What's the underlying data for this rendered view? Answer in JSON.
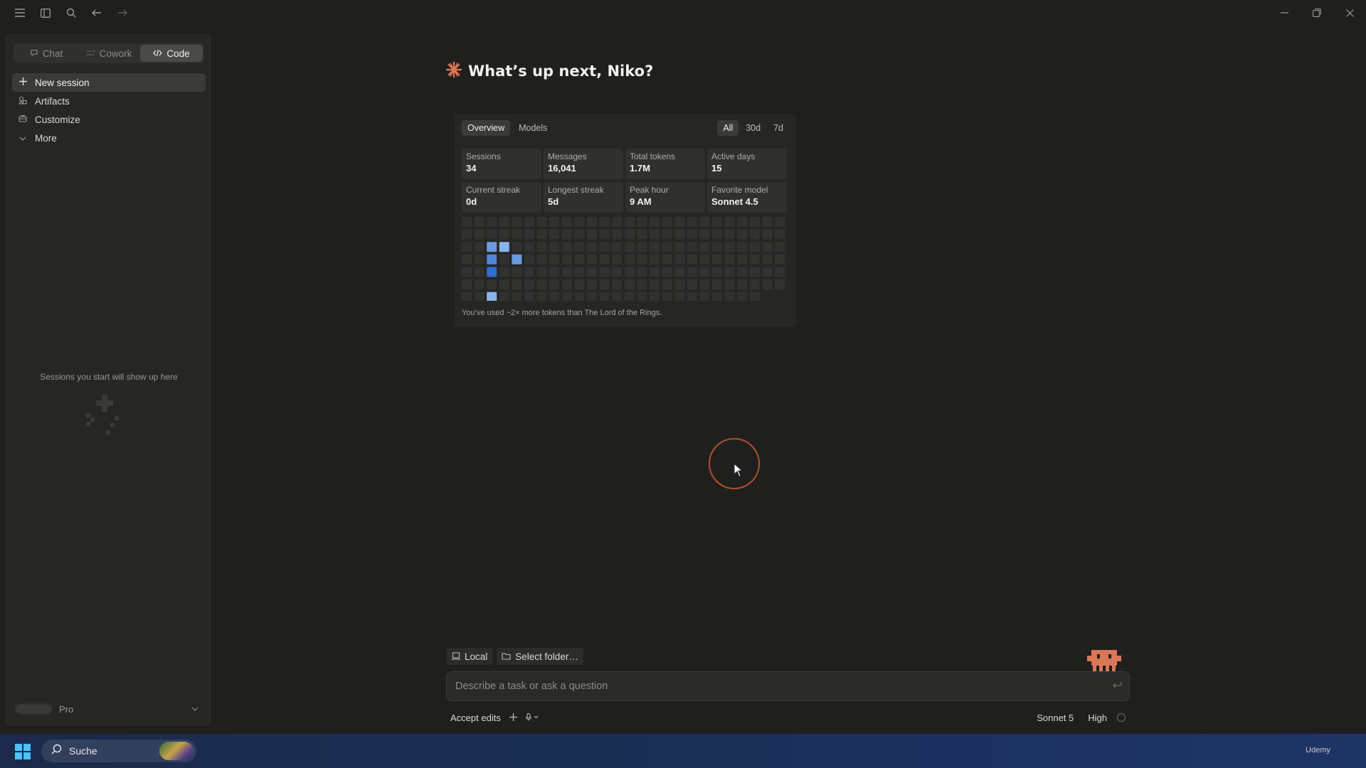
{
  "titlebar": {
    "icons": [
      "menu-icon",
      "sidebar-toggle-icon",
      "search-icon",
      "back-arrow-icon",
      "forward-arrow-icon"
    ],
    "window_controls": [
      "minimize-icon",
      "maximize-icon",
      "close-icon"
    ]
  },
  "sidebar": {
    "modes": [
      {
        "label": "Chat",
        "icon": "chat-icon",
        "active": false
      },
      {
        "label": "Cowork",
        "icon": "cowork-icon",
        "active": false
      },
      {
        "label": "Code",
        "icon": "code-icon",
        "active": true
      }
    ],
    "nav": [
      {
        "label": "New session",
        "icon": "plus-icon",
        "active": true
      },
      {
        "label": "Artifacts",
        "icon": "artifacts-icon",
        "active": false
      },
      {
        "label": "Customize",
        "icon": "customize-icon",
        "active": false
      },
      {
        "label": "More",
        "icon": "chevron-down-icon",
        "active": false
      }
    ],
    "empty_text": "Sessions you start will show up here",
    "account": {
      "plan": "Pro"
    }
  },
  "main": {
    "greeting": "What’s up next, Niko?",
    "accent_color": "#d97757"
  },
  "stats": {
    "tabs": [
      {
        "label": "Overview",
        "active": true
      },
      {
        "label": "Models",
        "active": false
      }
    ],
    "ranges": [
      {
        "label": "All",
        "active": true
      },
      {
        "label": "30d",
        "active": false
      },
      {
        "label": "7d",
        "active": false
      }
    ],
    "cards": [
      {
        "label": "Sessions",
        "value": "34"
      },
      {
        "label": "Messages",
        "value": "16,041"
      },
      {
        "label": "Total tokens",
        "value": "1.7M"
      },
      {
        "label": "Active days",
        "value": "15"
      },
      {
        "label": "Current streak",
        "value": "0d"
      },
      {
        "label": "Longest streak",
        "value": "5d"
      },
      {
        "label": "Peak hour",
        "value": "9 AM"
      },
      {
        "label": "Favorite model",
        "value": "Sonnet 4.5"
      }
    ],
    "heatmap": {
      "weeks": 26,
      "days": 7,
      "active_cells": [
        {
          "week": 2,
          "day": 2,
          "level": 2
        },
        {
          "week": 3,
          "day": 2,
          "level": 1
        },
        {
          "week": 2,
          "day": 3,
          "level": 3
        },
        {
          "week": 4,
          "day": 3,
          "level": 2
        },
        {
          "week": 2,
          "day": 4,
          "level": 4
        },
        {
          "week": 2,
          "day": 6,
          "level": 1
        }
      ],
      "colors": {
        "empty": "#313130",
        "l1": "#8ab4f0",
        "l2": "#6a9be0",
        "l3": "#4f86d8",
        "l4": "#2f6fd0"
      }
    },
    "caption": "You’ve used ~2× more tokens than The Lord of the Rings."
  },
  "composer": {
    "env_local": "Local",
    "env_folder": "Select folder…",
    "placeholder": "Describe a task or ask a question",
    "mode": "Accept edits",
    "model": "Sonnet 5",
    "effort": "High"
  },
  "taskbar": {
    "search_label": "Suche",
    "tray_label": "Udemy"
  }
}
